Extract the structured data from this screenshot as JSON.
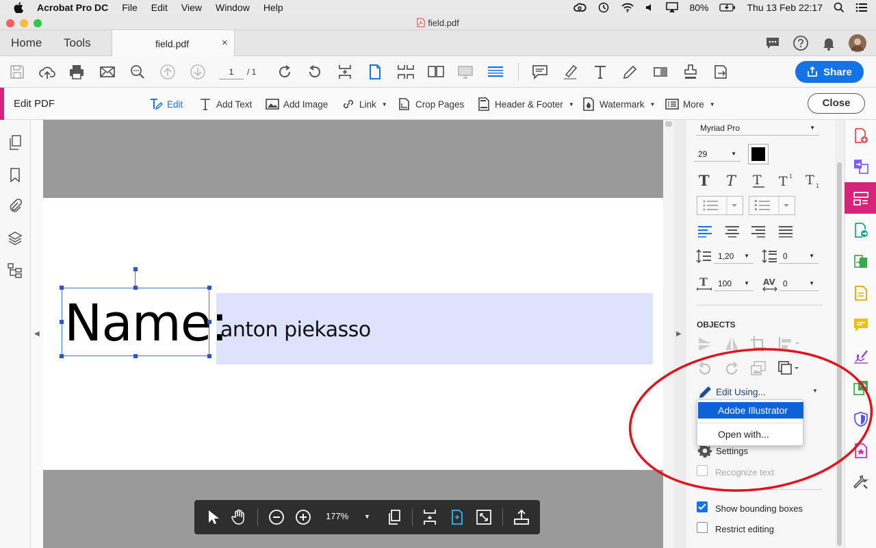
{
  "menubar": {
    "app": "Acrobat Pro DC",
    "items": [
      "File",
      "Edit",
      "View",
      "Window",
      "Help"
    ],
    "battery": "80%",
    "clock": "Thu 13 Feb  22:17"
  },
  "window": {
    "title": "field.pdf"
  },
  "tabs": {
    "home": "Home",
    "tools": "Tools",
    "doc": "field.pdf",
    "close": "×"
  },
  "toolbar": {
    "page_current": "1",
    "page_total": "/ 1",
    "share": "Share"
  },
  "editbar": {
    "title": "Edit PDF",
    "edit": "Edit",
    "add_text": "Add Text",
    "add_image": "Add Image",
    "link": "Link",
    "crop": "Crop Pages",
    "header_footer": "Header & Footer",
    "watermark": "Watermark",
    "more": "More",
    "close": "Close"
  },
  "document": {
    "label": "Name:",
    "field_value": "anton piekasso"
  },
  "zoombar": {
    "zoom": "177%"
  },
  "format_panel": {
    "font": "Myriad Pro",
    "size": "29",
    "text_color": "#000000",
    "line_spacing": "1,20",
    "paragraph_spacing": "0",
    "horizontal_scale": "100",
    "char_spacing": "0"
  },
  "objects_panel": {
    "heading": "OBJECTS",
    "edit_using": "Edit Using...",
    "menu": {
      "selected": "Adobe Illustrator",
      "open_with": "Open with..."
    },
    "settings": "Settings",
    "recognize_text": "Recognize text",
    "show_bounding_boxes": "Show bounding boxes",
    "restrict_editing": "Restrict editing"
  },
  "colors": {
    "accent_blue": "#1473e6",
    "edit_pink": "#d6247a",
    "annotation_red": "#e0141c",
    "field_fill": "#dde3fb"
  }
}
